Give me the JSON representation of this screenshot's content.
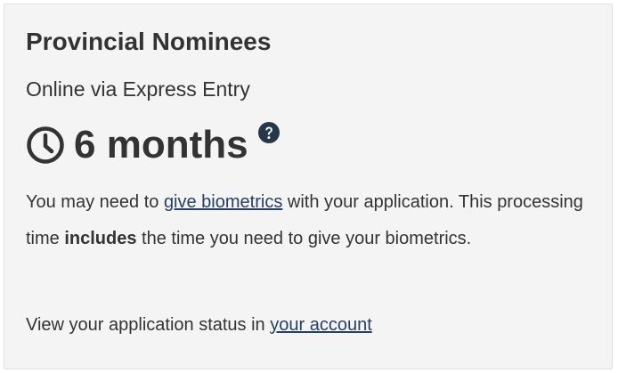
{
  "card": {
    "title": "Provincial Nominees",
    "subtitle": "Online via Express Entry",
    "processing_time": "6 months",
    "clock_icon": "clock-icon",
    "help_icon": "question-circle-icon",
    "biometrics_text": {
      "part1": "You may need to ",
      "link": "give biometrics",
      "part2": " with your application. This processing time ",
      "bold": "includes",
      "part3": " the time you need to give your biometrics."
    },
    "status_text": {
      "prefix": "View your application status in ",
      "link": "your account"
    }
  },
  "colors": {
    "card_background": "#f4f4f4",
    "text": "#333333",
    "link": "#284162",
    "help_icon": "#26374a"
  }
}
